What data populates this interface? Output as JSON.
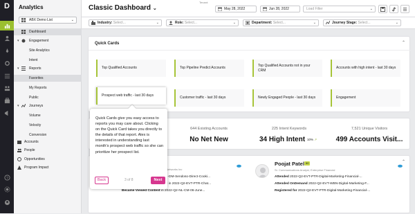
{
  "app": {
    "logo_letter": "D",
    "title": "Analytics"
  },
  "rail_icons": [
    "chart-icon",
    "person-icon",
    "rocket-icon",
    "gear-icon",
    "list-icon",
    "people-icon",
    "briefcase-icon",
    "megaphone-icon",
    "help-icon",
    "settings-icon",
    "user-icon"
  ],
  "sidebar": {
    "select_label": "ABX Demo List",
    "items": [
      {
        "label": "Dashboard"
      },
      {
        "label": "Engagement"
      },
      {
        "label": "Site Analytics"
      },
      {
        "label": "Intent"
      },
      {
        "label": "Reports"
      },
      {
        "label": "Favorites"
      },
      {
        "label": "My Reports"
      },
      {
        "label": "Public"
      },
      {
        "label": "Journeys"
      },
      {
        "label": "Volume"
      },
      {
        "label": "Velocity"
      },
      {
        "label": "Conversion"
      },
      {
        "label": "Accounts"
      },
      {
        "label": "People"
      },
      {
        "label": "Opportunities"
      },
      {
        "label": "Program Impact"
      }
    ]
  },
  "header": {
    "title": "Classic Dashboard",
    "tenant_label": "Tenant:",
    "date_from": "May 28, 2022",
    "date_to": "Jun 28, 2022",
    "load_filter_placeholder": "Load Filter"
  },
  "filters": [
    {
      "label": "Industry:",
      "placeholder": "Select..."
    },
    {
      "label": "Role:",
      "placeholder": "Select..."
    },
    {
      "label": "Department:",
      "placeholder": "Select..."
    },
    {
      "label": "Journey Stage:",
      "placeholder": "Select..."
    }
  ],
  "quick_cards": {
    "title": "Quick Cards",
    "cards": [
      "Top Qualified Accounts",
      "Top Pipeline Predict Accounts",
      "Top Qualified Accounts not in your CRM",
      "Accounts with high intent - last 30 days",
      "Prospect web traffic - last 30 days",
      "Customer traffic - last 30 days",
      "Newly Engaged People - last 30 days",
      "Engagement"
    ]
  },
  "kpis": [
    {
      "sub": "",
      "big": ""
    },
    {
      "sub": "644 Existing Accounts",
      "big": "No Net New"
    },
    {
      "sub": "225 Intent Keywords",
      "big": "34 High Intent",
      "trend": "10%"
    },
    {
      "sub": "7,521 Unique Visitors",
      "big": "499 Accounts Visit..."
    }
  ],
  "people": [
    {
      "name": "",
      "badge": "",
      "sub": "Marketing Strategy/Operations, Abc Networks Inc",
      "acts": [
        {
          "kind": "Became Delivered",
          "text": "in 2022-Q2-DM-Sendoso-Direct-Cooki..."
        },
        {
          "kind": "Became Post-Event Engaged",
          "text": "in 2022-Q2-EVT-PTR-Chat..."
        },
        {
          "kind": "Became Viewed Content",
          "text": "in 2022-Q2-NL-CM-06-June..."
        }
      ]
    },
    {
      "name": "Poojat Patel",
      "badge": "80",
      "sub": "Sr. Communications Analyst, Enterprise Financial",
      "acts": [
        {
          "kind": "Attended",
          "text": "2022-Q2-EVT-PTR-Digital-Marketing-Financial-..."
        },
        {
          "kind": "Attended OnDemand",
          "text": "2022-Q2-EVT-WBN-Digital-Marketing-F..."
        },
        {
          "kind": "Registered for",
          "text": "2022-Q2-EVT-PTR-Digital-Marketing-Financial-..."
        }
      ]
    }
  ],
  "tooltip": {
    "body": "Quick Cards give you easy access to reports you may care about. Clicking on the Quick Card takes you directly to the details of that report. Alex is interested in understanding last month's prospect web traffic so she can prioritize her prospect list.",
    "back_label": "Back",
    "step_label": "3 of 8",
    "next_label": "Next"
  },
  "colors": {
    "accent": "#9bbf2f",
    "rail_bg": "#1f1f26",
    "tour_pink": "#d6368f",
    "card_border": "#a6c437"
  }
}
